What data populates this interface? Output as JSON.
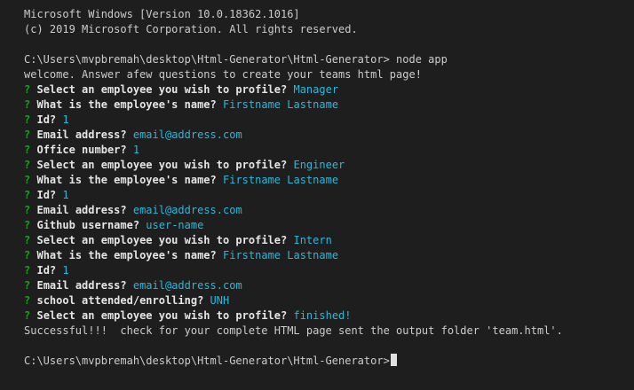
{
  "header": {
    "version": "Microsoft Windows [Version 10.0.18362.1016]",
    "copyright": "(c) 2019 Microsoft Corporation. All rights reserved."
  },
  "command": {
    "prompt": "C:\\Users\\mvpbremah\\desktop\\Html-Generator\\Html-Generator>",
    "input": " node app"
  },
  "welcome": "welcome. Answer afew questions to create your teams html page!",
  "question_marker": "?",
  "qa": [
    {
      "q": "Select an employee you wish to profile?",
      "a": "Manager"
    },
    {
      "q": "What is the employee's name?",
      "a": "Firstname Lastname"
    },
    {
      "q": "Id?",
      "a": "1"
    },
    {
      "q": "Email address?",
      "a": "email@address.com"
    },
    {
      "q": "Office number?",
      "a": "1"
    },
    {
      "q": "Select an employee you wish to profile?",
      "a": "Engineer"
    },
    {
      "q": "What is the employee's name?",
      "a": "Firstname Lastname"
    },
    {
      "q": "Id?",
      "a": "1"
    },
    {
      "q": "Email address?",
      "a": "email@address.com"
    },
    {
      "q": "Github username?",
      "a": "user-name"
    },
    {
      "q": "Select an employee you wish to profile?",
      "a": "Intern"
    },
    {
      "q": "What is the employee's name?",
      "a": "Firstname Lastname"
    },
    {
      "q": "Id?",
      "a": "1"
    },
    {
      "q": "Email address?",
      "a": "email@address.com"
    },
    {
      "q": "school attended/enrolling?",
      "a": "UNH"
    },
    {
      "q": "Select an employee you wish to profile?",
      "a": "finished!"
    }
  ],
  "success": "Successful!!!  check for your complete HTML page sent the output folder 'team.html'.",
  "final_prompt": "C:\\Users\\mvpbremah\\desktop\\Html-Generator\\Html-Generator>",
  "colors": {
    "background": "#1e1e1e",
    "text": "#cccccc",
    "question_marker": "#19a119",
    "answer": "#29b8db"
  }
}
